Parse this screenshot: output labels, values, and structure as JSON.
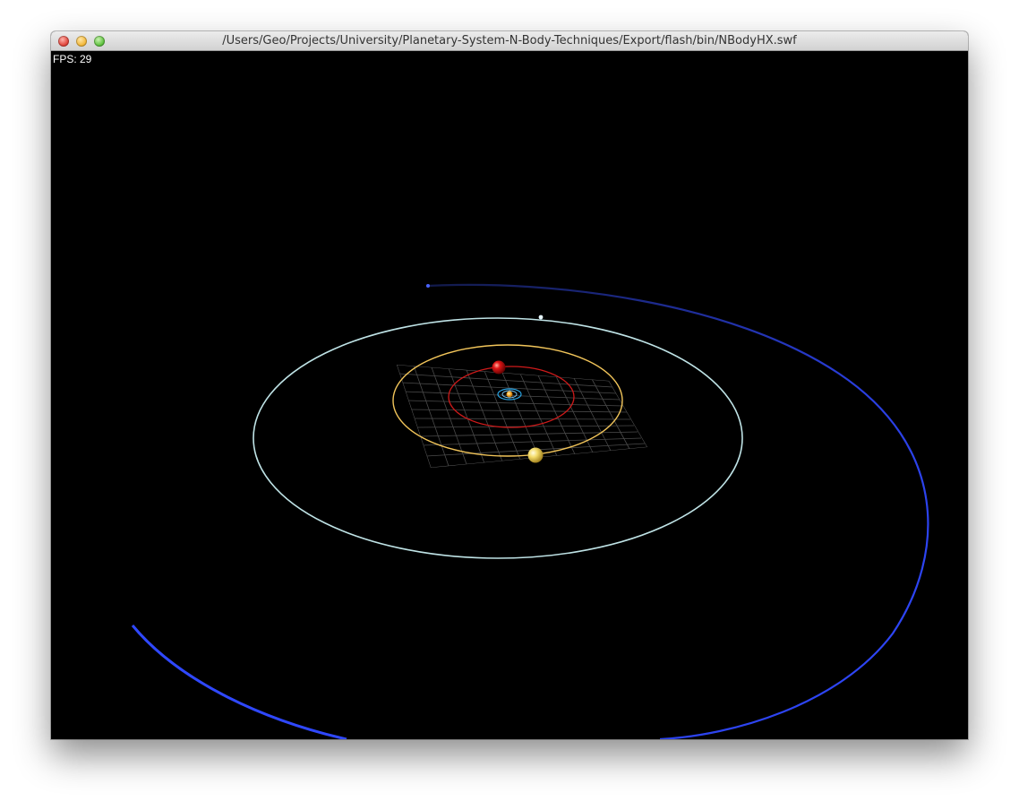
{
  "window": {
    "title": "/Users/Geo/Projects/University/Planetary-System-N-Body-Techniques/Export/flash/bin/NBodyHX.swf"
  },
  "hud": {
    "fps_label": "FPS: 29"
  },
  "colors": {
    "background": "#000000",
    "outer_orbit": "#2f48ff",
    "pale_orbit": "#bfe3e6",
    "yellow_orbit": "#f2c55a",
    "red_orbit": "#d01818",
    "inner_orbit": "#32b6e6",
    "grid": "#555555"
  },
  "icons": [
    "close-icon",
    "minimize-icon",
    "zoom-icon"
  ]
}
